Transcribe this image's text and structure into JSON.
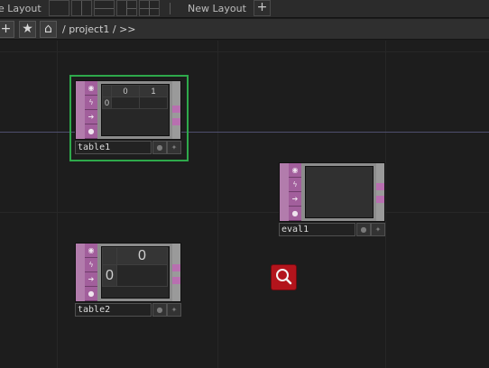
{
  "layout_bar": {
    "current_layout_label": "e Layout",
    "new_layout_label": "New Layout",
    "add_label": "+"
  },
  "path_bar": {
    "add_label": "+",
    "favorite_label": "★",
    "home_label": "⌂",
    "path": "/ project1 / >>"
  },
  "nodes": [
    {
      "name": "table1",
      "type": "DAT",
      "selected": true,
      "table": {
        "header": [
          "",
          "0",
          "1"
        ],
        "rows": [
          [
            "0",
            "",
            ""
          ]
        ]
      }
    },
    {
      "name": "eval1",
      "type": "DAT",
      "selected": false
    },
    {
      "name": "table2",
      "type": "DAT",
      "selected": false,
      "table": {
        "header": [
          "",
          "0"
        ],
        "rows": [
          [
            "0",
            ""
          ]
        ]
      }
    }
  ],
  "colors": {
    "dat_family": "#a25f9c",
    "selection": "#2ea94b",
    "search_button": "#b3141c",
    "canvas_background": "#1d1d1d"
  },
  "icons": {
    "node_tabs": [
      "viewer-toggle-icon",
      "cook-icon",
      "export-icon",
      "bypass-icon"
    ],
    "search": "magnifier-icon"
  }
}
